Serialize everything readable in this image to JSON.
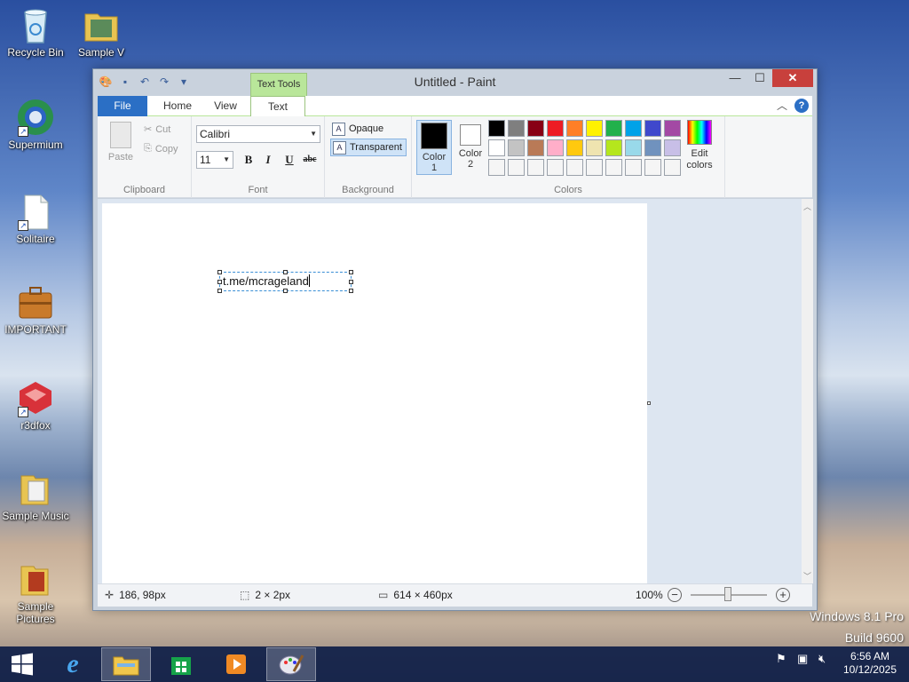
{
  "desktop": {
    "icons": [
      {
        "label": "Recycle Bin"
      },
      {
        "label": "Sample V"
      },
      {
        "label": "Supermium"
      },
      {
        "label": "Solitaire"
      },
      {
        "label": "IMPORTANT"
      },
      {
        "label": "r3dfox"
      },
      {
        "label": "Sample Music"
      },
      {
        "label": "Sample Pictures"
      }
    ],
    "watermark_line1": "Windows 8.1 Pro",
    "watermark_line2": "Build 9600"
  },
  "window": {
    "title": "Untitled - Paint",
    "context_tab": "Text Tools",
    "tabs": {
      "file": "File",
      "home": "Home",
      "view": "View",
      "text": "Text"
    },
    "clipboard": {
      "paste": "Paste",
      "cut": "Cut",
      "copy": "Copy",
      "group": "Clipboard"
    },
    "font": {
      "family": "Calibri",
      "size": "11",
      "bold": "B",
      "italic": "I",
      "underline": "U",
      "strike": "abc",
      "group": "Font"
    },
    "background": {
      "opaque": "Opaque",
      "transparent": "Transparent",
      "group": "Background",
      "selected": "transparent"
    },
    "colors": {
      "color1_label": "Color",
      "color1_num": "1",
      "color2_label": "Color",
      "color2_num": "2",
      "color1": "#000000",
      "color2": "#ffffff",
      "edit_label1": "Edit",
      "edit_label2": "colors",
      "group": "Colors",
      "palette": [
        "#000000",
        "#7f7f7f",
        "#880015",
        "#ed1c24",
        "#ff7f27",
        "#fff200",
        "#22b14c",
        "#00a2e8",
        "#3f48cc",
        "#a349a4",
        "#ffffff",
        "#c3c3c3",
        "#b97a57",
        "#ffaec9",
        "#ffc90e",
        "#efe4b0",
        "#b5e61d",
        "#99d9ea",
        "#7092be",
        "#c8bfe7",
        "#f5f5f5",
        "#f5f5f5",
        "#f5f5f5",
        "#f5f5f5",
        "#f5f5f5",
        "#f5f5f5",
        "#f5f5f5",
        "#f5f5f5",
        "#f5f5f5",
        "#f5f5f5"
      ]
    },
    "canvas_text": "t.me/mcrageland",
    "status": {
      "cursor": "186, 98px",
      "selection": "2 × 2px",
      "canvas_size": "614 × 460px",
      "zoom": "100%"
    }
  },
  "taskbar": {
    "time": "6:56 AM",
    "date": "10/12/2025"
  }
}
